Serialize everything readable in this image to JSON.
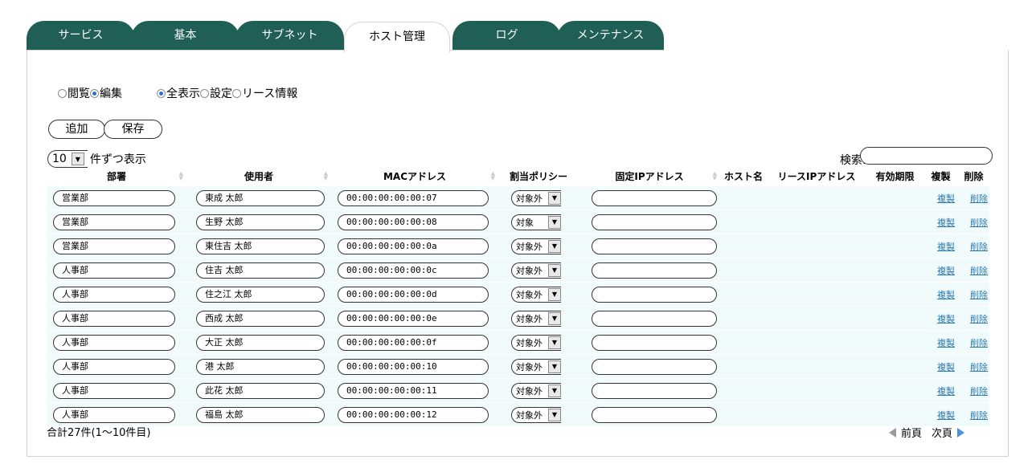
{
  "tabs": [
    {
      "label": "サービス",
      "active": false
    },
    {
      "label": "基本",
      "active": false
    },
    {
      "label": "サブネット",
      "active": false
    },
    {
      "label": "ホスト管理",
      "active": true
    },
    {
      "label": "ログ",
      "active": false
    },
    {
      "label": "メンテナンス",
      "active": false
    }
  ],
  "mode": {
    "view": "閲覧",
    "edit": "編集",
    "selected": "編集"
  },
  "display": {
    "all": "全表示",
    "settings": "設定",
    "lease": "リース情報",
    "selected": "全表示"
  },
  "buttons": {
    "add": "追加",
    "save": "保存"
  },
  "page_size": {
    "value": "10",
    "label": "件ずつ表示"
  },
  "search": {
    "label": "検索:",
    "value": ""
  },
  "columns": [
    "部署",
    "使用者",
    "MACアドレス",
    "割当ポリシー",
    "固定IPアドレス",
    "ホスト名",
    "リースIPアドレス",
    "有効期限",
    "複製",
    "削除"
  ],
  "rows": [
    {
      "dept": "営業部",
      "user": "東成 太郎",
      "mac": "00:00:00:00:00:07",
      "policy": "対象外",
      "ip": ""
    },
    {
      "dept": "営業部",
      "user": "生野 太郎",
      "mac": "00:00:00:00:00:08",
      "policy": "対象",
      "ip": ""
    },
    {
      "dept": "営業部",
      "user": "東住吉 太郎",
      "mac": "00:00:00:00:00:0a",
      "policy": "対象外",
      "ip": ""
    },
    {
      "dept": "人事部",
      "user": "住吉 太郎",
      "mac": "00:00:00:00:00:0c",
      "policy": "対象外",
      "ip": ""
    },
    {
      "dept": "人事部",
      "user": "住之江 太郎",
      "mac": "00:00:00:00:00:0d",
      "policy": "対象外",
      "ip": ""
    },
    {
      "dept": "人事部",
      "user": "西成 太郎",
      "mac": "00:00:00:00:00:0e",
      "policy": "対象外",
      "ip": ""
    },
    {
      "dept": "人事部",
      "user": "大正 太郎",
      "mac": "00:00:00:00:00:0f",
      "policy": "対象外",
      "ip": ""
    },
    {
      "dept": "人事部",
      "user": "港 太郎",
      "mac": "00:00:00:00:00:10",
      "policy": "対象外",
      "ip": ""
    },
    {
      "dept": "人事部",
      "user": "此花 太郎",
      "mac": "00:00:00:00:00:11",
      "policy": "対象外",
      "ip": ""
    },
    {
      "dept": "人事部",
      "user": "福島 太郎",
      "mac": "00:00:00:00:00:12",
      "policy": "対象外",
      "ip": ""
    }
  ],
  "row_actions": {
    "copy": "複製",
    "delete": "削除"
  },
  "summary": "合計27件(1～10件目)",
  "pager": {
    "prev": "前頁",
    "next": "次頁"
  },
  "colors": {
    "tab_bg": "#1f5f56",
    "row_bg": "#f1fbfb",
    "link": "#2a7ab0",
    "pager_next": "#4a90e2"
  }
}
